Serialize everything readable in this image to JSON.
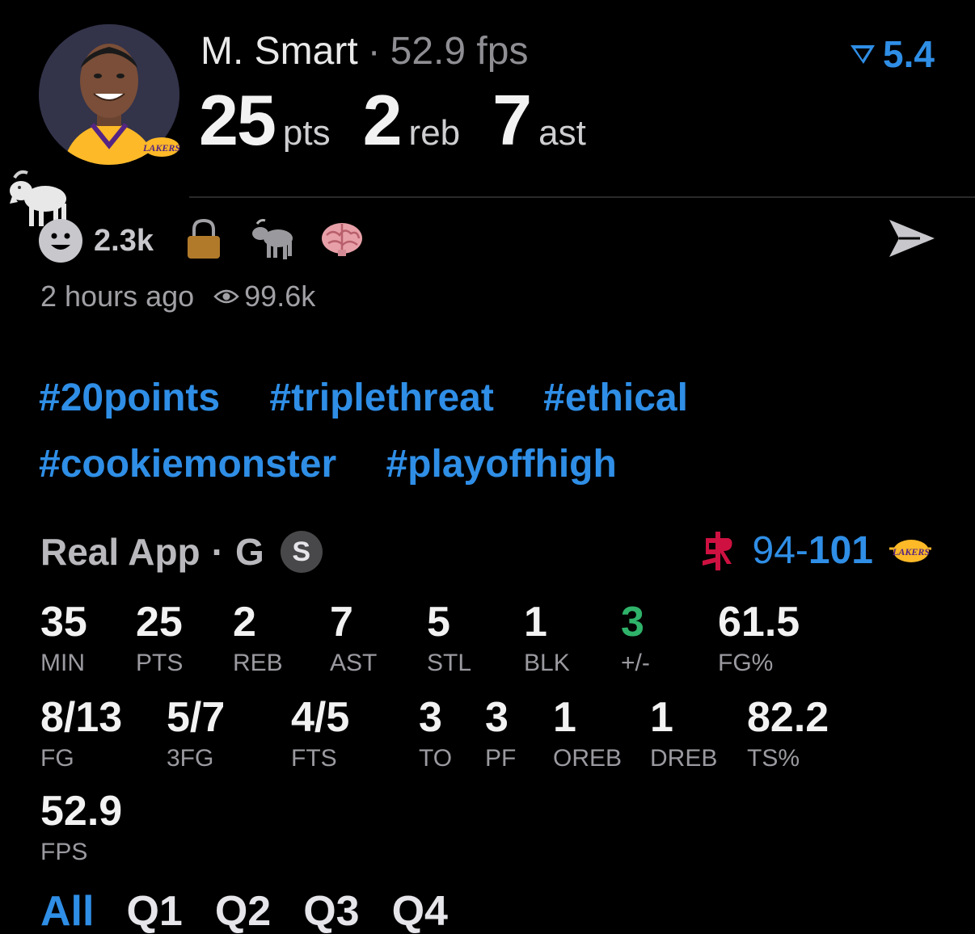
{
  "header": {
    "player_name": "M. Smart",
    "separator": "·",
    "fps_label": "52.9 fps",
    "rating": "5.4",
    "stat_line": [
      {
        "value": "25",
        "unit": "pts"
      },
      {
        "value": "2",
        "unit": "reb"
      },
      {
        "value": "7",
        "unit": "ast"
      }
    ],
    "team_logo_text": "LAKERS"
  },
  "reactions": {
    "count": "2.3k",
    "icons": [
      "smiley-face-icon",
      "lock-icon",
      "goat-icon",
      "brain-icon"
    ],
    "send_icon": "send-icon"
  },
  "meta": {
    "time_ago": "2 hours ago",
    "views": "99.6k"
  },
  "hashtags": [
    "#20points",
    "#triplethreat",
    "#ethical",
    "#cookiemonster",
    "#playoffhigh"
  ],
  "game": {
    "source": "Real App",
    "separator": "·",
    "position": "G",
    "badge": "S",
    "score_left": "94",
    "score_dash": "-",
    "score_right": "101"
  },
  "stats_row1": [
    {
      "value": "35",
      "label": "MIN"
    },
    {
      "value": "25",
      "label": "PTS"
    },
    {
      "value": "2",
      "label": "REB"
    },
    {
      "value": "7",
      "label": "AST"
    },
    {
      "value": "5",
      "label": "STL"
    },
    {
      "value": "1",
      "label": "BLK"
    },
    {
      "value": "3",
      "label": "+/-"
    },
    {
      "value": "61.5",
      "label": "FG%"
    }
  ],
  "stats_row2": [
    {
      "value": "8/13",
      "label": "FG"
    },
    {
      "value": "5/7",
      "label": "3FG"
    },
    {
      "value": "4/5",
      "label": "FTS"
    },
    {
      "value": "3",
      "label": "TO"
    },
    {
      "value": "3",
      "label": "PF"
    },
    {
      "value": "1",
      "label": "OREB"
    },
    {
      "value": "1",
      "label": "DREB"
    },
    {
      "value": "82.2",
      "label": "TS%"
    }
  ],
  "stats_row3": [
    {
      "value": "52.9",
      "label": "FPS"
    }
  ],
  "tabs": [
    "All",
    "Q1",
    "Q2",
    "Q3",
    "Q4"
  ],
  "colors": {
    "accent": "#2f8ee6",
    "positive": "#2fb36a",
    "rockets_red": "#ce1141",
    "lakers_gold": "#fdb927",
    "lakers_purple": "#552583"
  }
}
